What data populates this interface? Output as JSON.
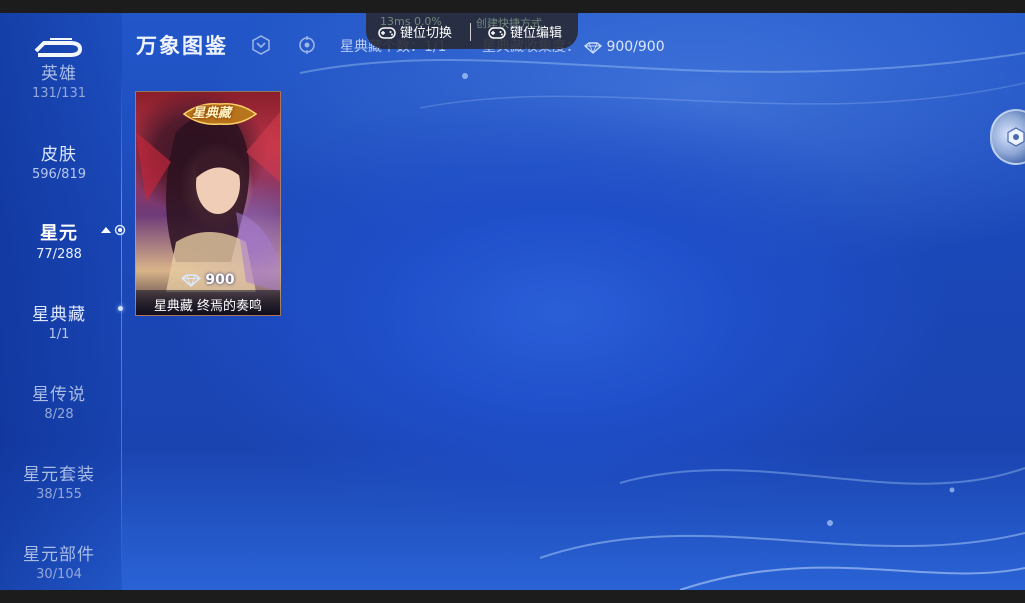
{
  "header": {
    "title": "万象图鉴",
    "stat_count": "星典藏个数：1/1",
    "stat_value_label": "星典藏收集度：",
    "stat_value": "900/900"
  },
  "overlay": {
    "key_switch_label": "键位切换",
    "key_edit_label": "键位编辑",
    "ghost_left": "13ms   0.0%",
    "ghost_right": "创建快捷方式"
  },
  "sidebar": {
    "items": [
      {
        "label": "英雄",
        "count": "131/131"
      },
      {
        "label": "皮肤",
        "count": "596/819"
      },
      {
        "label": "星元",
        "count": "77/288"
      },
      {
        "label": "星典藏",
        "count": "1/1"
      },
      {
        "label": "星传说",
        "count": "8/28"
      },
      {
        "label": "星元套装",
        "count": "38/155"
      },
      {
        "label": "星元部件",
        "count": "30/104"
      }
    ]
  },
  "card": {
    "badge": "星典藏",
    "price": "900",
    "name": "星典藏  终焉的奏鸣"
  },
  "icons": {
    "back": "back-arrow-icon",
    "hex_filter": "hexagon-filter-icon",
    "target": "target-icon",
    "gem": "gem-icon",
    "gamepad": "gamepad-icon",
    "settings": "settings-hex-icon"
  },
  "colors": {
    "background": "#1f4ec9",
    "accent": "#cfe3ff"
  }
}
